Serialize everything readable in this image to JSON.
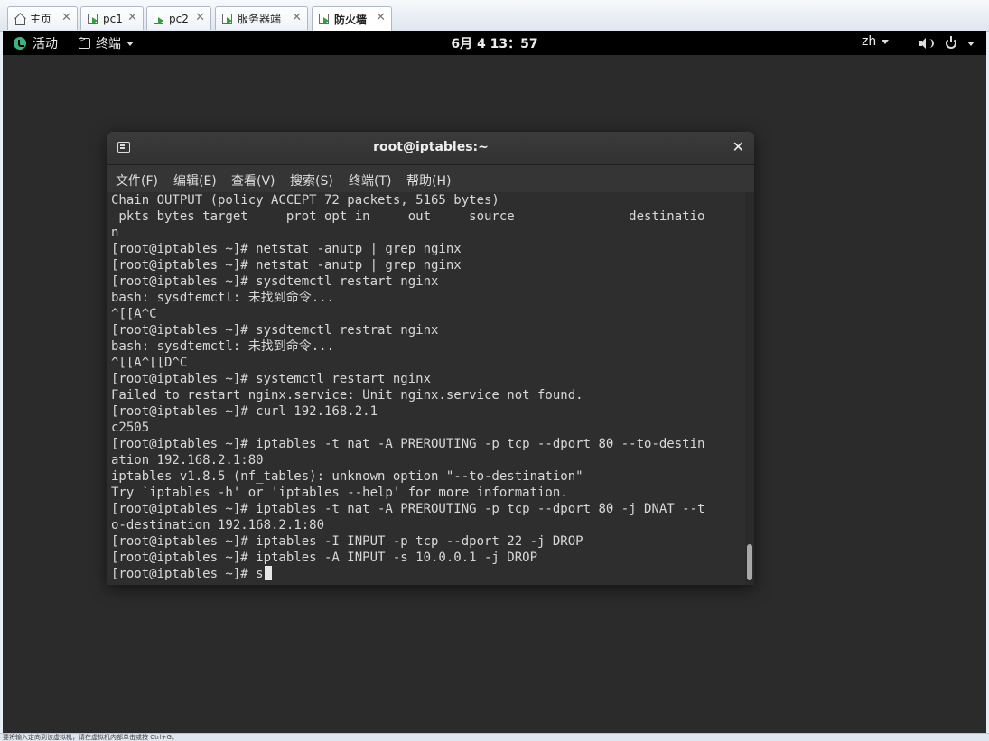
{
  "tabs": [
    {
      "label": "主页",
      "icon": "home-icon",
      "active": false
    },
    {
      "label": "pc1",
      "icon": "vm-icon",
      "active": false
    },
    {
      "label": "pc2",
      "icon": "vm-icon",
      "active": false
    },
    {
      "label": "服务器端",
      "icon": "vm-icon",
      "active": false
    },
    {
      "label": "防火墙",
      "icon": "vm-icon",
      "active": true
    }
  ],
  "topbar": {
    "activities": "活动",
    "app_menu": "终端",
    "clock": "6月 4  13：57",
    "input_method": "zh"
  },
  "terminal": {
    "title": "root@iptables:~",
    "menu": [
      "文件(F)",
      "编辑(E)",
      "查看(V)",
      "搜索(S)",
      "终端(T)",
      "帮助(H)"
    ],
    "lines": [
      "Chain OUTPUT (policy ACCEPT 72 packets, 5165 bytes)",
      " pkts bytes target     prot opt in     out     source               destinatio",
      "n",
      "[root@iptables ~]# netstat -anutp | grep nginx",
      "[root@iptables ~]# netstat -anutp | grep nginx",
      "[root@iptables ~]# sysdtemctl restart nginx",
      "bash: sysdtemctl: 未找到命令...",
      "^[[A^C",
      "[root@iptables ~]# sysdtemctl restrat nginx",
      "bash: sysdtemctl: 未找到命令...",
      "^[[A^[[D^C",
      "[root@iptables ~]# systemctl restart nginx",
      "Failed to restart nginx.service: Unit nginx.service not found.",
      "[root@iptables ~]# curl 192.168.2.1",
      "c2505",
      "[root@iptables ~]# iptables -t nat -A PREROUTING -p tcp --dport 80 --to-destin",
      "ation 192.168.2.1:80",
      "iptables v1.8.5 (nf_tables): unknown option \"--to-destination\"",
      "Try `iptables -h' or 'iptables --help' for more information.",
      "[root@iptables ~]# iptables -t nat -A PREROUTING -p tcp --dport 80 -j DNAT --t",
      "o-destination 192.168.2.1:80",
      "[root@iptables ~]# iptables -I INPUT -p tcp --dport 22 -j DROP",
      "[root@iptables ~]# iptables -A INPUT -s 10.0.0.1 -j DROP",
      "[root@iptables ~]# s"
    ]
  },
  "status": {
    "text": "要将输入定向到该虚拟机，请在虚拟机内部单击或按 Ctrl+G。"
  },
  "colors": {
    "desktop": "#2b2b2b",
    "terminal_bg": "#2e2e2e",
    "terminal_fg": "#d8d8d8",
    "topbar": "#000000",
    "activities_icon": "#3fb37f"
  }
}
